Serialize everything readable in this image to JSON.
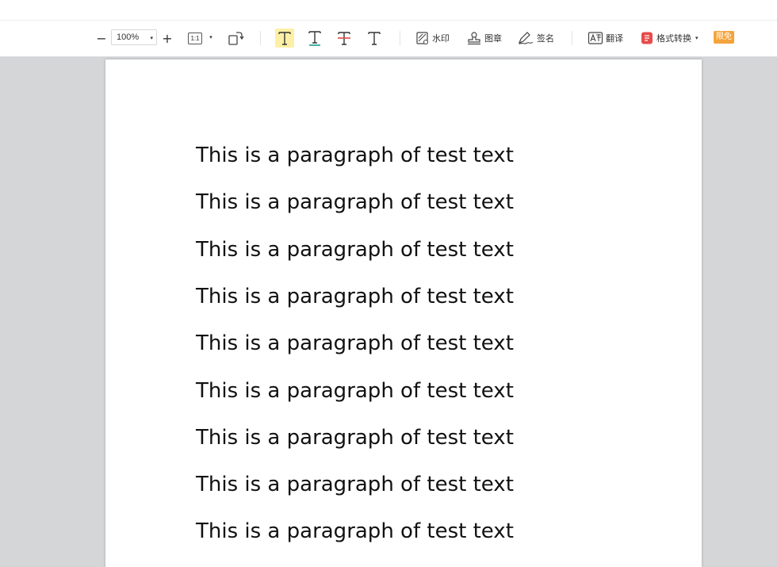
{
  "toolbar": {
    "zoom_out_symbol": "−",
    "zoom_value": "100%",
    "zoom_in_symbol": "+",
    "actual_size_label": "1:1",
    "dropdown_caret": "▾",
    "watermark_label": "水印",
    "stamp_label": "图章",
    "signature_label": "签名",
    "translate_label": "翻译",
    "convert_label": "格式转换",
    "badge_label": "限免",
    "highlight_color": "#fdf0a6",
    "underline_color": "#1a9c8c",
    "strikethrough_color": "#e04848",
    "convert_icon_color": "#e84a4a",
    "badge_color": "#f5a33b",
    "icons": [
      "zoom-out-icon",
      "zoom-in-icon",
      "actual-size-icon",
      "rotate-icon",
      "highlight-text-icon",
      "underline-text-icon",
      "strikethrough-text-icon",
      "add-text-icon",
      "watermark-icon",
      "stamp-icon",
      "signature-icon",
      "translate-icon",
      "format-convert-icon"
    ]
  },
  "document": {
    "paragraphs": [
      "This is a paragraph of test text",
      "This is a paragraph of test text",
      "This is a paragraph of test text",
      "This is a paragraph of test text",
      "This is a paragraph of test text",
      "This is a paragraph of test text",
      "This is a paragraph of test text",
      "This is a paragraph of test text",
      "This is a paragraph of test text"
    ]
  }
}
